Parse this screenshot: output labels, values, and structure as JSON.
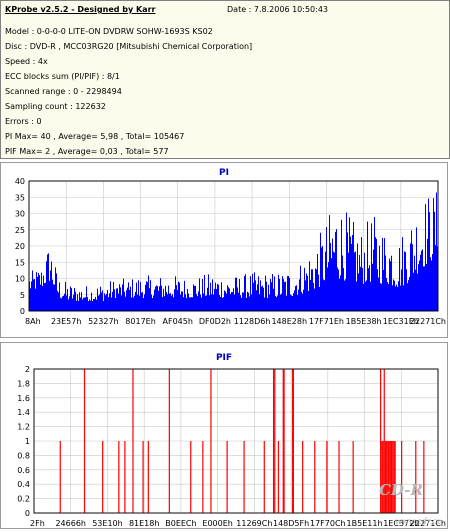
{
  "header": {
    "title": "KProbe v2.5.2 - Designed by Karr",
    "date": "Date : 7.8.2006 10:50:43"
  },
  "info_lines": [
    "Model : 0-0-0-0 LITE-ON DVDRW SOHW-1693S KS02",
    "Disc : DVD-R , MCC03RG20 [Mitsubishi Chemical Corporation]",
    "Speed : 4x",
    "ECC blocks sum (PI/PIF) : 8/1",
    "Scanned range : 0 - 2298494",
    "Sampling count : 122632",
    "Errors : 0",
    "PI Max= 40 , Average= 5,98 , Total= 105467",
    "PIF Max= 2 , Average= 0,03 , Total= 577"
  ],
  "watermark": "CD-R",
  "watermark_url": "www.cdr.cz",
  "colors": {
    "pi": "#0000ff",
    "pif": "#ff0000",
    "title": "#0000c0",
    "info_bg": "#fdfcec"
  },
  "chart_data": [
    {
      "type": "area",
      "title": "PI",
      "ylim": [
        0,
        40
      ],
      "yticks": [
        0,
        5,
        10,
        15,
        20,
        25,
        30,
        35,
        40
      ],
      "xtick_labels": [
        "8Ah",
        "23E57h",
        "52327h",
        "8017Eh",
        "AF045h",
        "DF0D2h",
        "1128D6h",
        "148E28h",
        "17F71Eh",
        "1B5E38h",
        "1EC31Eh",
        "22271Ch"
      ],
      "grid": true,
      "envelope_x": [
        0,
        3,
        5,
        7,
        9,
        12,
        15,
        18,
        21,
        24,
        27,
        30,
        33,
        36,
        39,
        42,
        45,
        48,
        51,
        54,
        57,
        60,
        63,
        66,
        69,
        72,
        75,
        78,
        81,
        84,
        87,
        88,
        90,
        92,
        94,
        96,
        98,
        100
      ],
      "envelope_y": [
        12,
        14,
        22,
        11,
        9,
        8,
        8,
        9,
        10,
        10,
        11,
        11,
        11,
        11,
        10,
        11,
        12,
        11,
        11,
        12,
        12,
        12,
        13,
        15,
        20,
        26,
        36,
        30,
        25,
        30,
        26,
        27,
        22,
        27,
        32,
        36,
        37,
        38
      ],
      "baseline_y": [
        6,
        7,
        9,
        4,
        3,
        3,
        3,
        3,
        4,
        4,
        4,
        4,
        4,
        4,
        4,
        4,
        4,
        4,
        4,
        4,
        4,
        4,
        4,
        5,
        6,
        8,
        10,
        9,
        8,
        9,
        8,
        8,
        7,
        8,
        10,
        13,
        15,
        17
      ]
    },
    {
      "type": "bar",
      "title": "PIF",
      "ylim": [
        0,
        2
      ],
      "yticks": [
        0,
        0.2,
        0.4,
        0.6,
        0.8,
        1,
        1.2,
        1.4,
        1.6,
        1.8,
        2
      ],
      "xtick_labels": [
        "2Fh",
        "24666h",
        "53E10h",
        "81E18h",
        "B0EECh",
        "E000Eh",
        "11269Ch",
        "148D5Fh",
        "17F70Ch",
        "1B5E11h",
        "1EC372h",
        "22271Ch"
      ],
      "grid": true,
      "spikes_x": [
        6.5,
        12.5,
        17,
        21,
        22.5,
        24.5,
        27,
        28.3,
        33.5,
        38.8,
        41.8,
        43.8,
        47.8,
        52,
        57,
        59.3,
        59.6,
        60.5,
        61.7,
        61.9,
        64,
        64.2,
        66.5,
        69.5,
        72.5,
        75.5,
        79,
        85.8,
        86.1,
        86.4,
        86.7,
        87,
        87.3,
        87.6,
        87.9,
        88.2,
        88.5,
        88.8,
        89.1,
        89.4,
        91,
        94.5,
        96.5
      ],
      "spikes_y": [
        1,
        2,
        1,
        1,
        1,
        2,
        1,
        1,
        2,
        1,
        1,
        2,
        1,
        1,
        1,
        2,
        2,
        1,
        2,
        2,
        2,
        2,
        1,
        1,
        1,
        1,
        1,
        2,
        1,
        1,
        2,
        1,
        1,
        1,
        1,
        1,
        1,
        1,
        1,
        1,
        1,
        1,
        1
      ]
    }
  ]
}
